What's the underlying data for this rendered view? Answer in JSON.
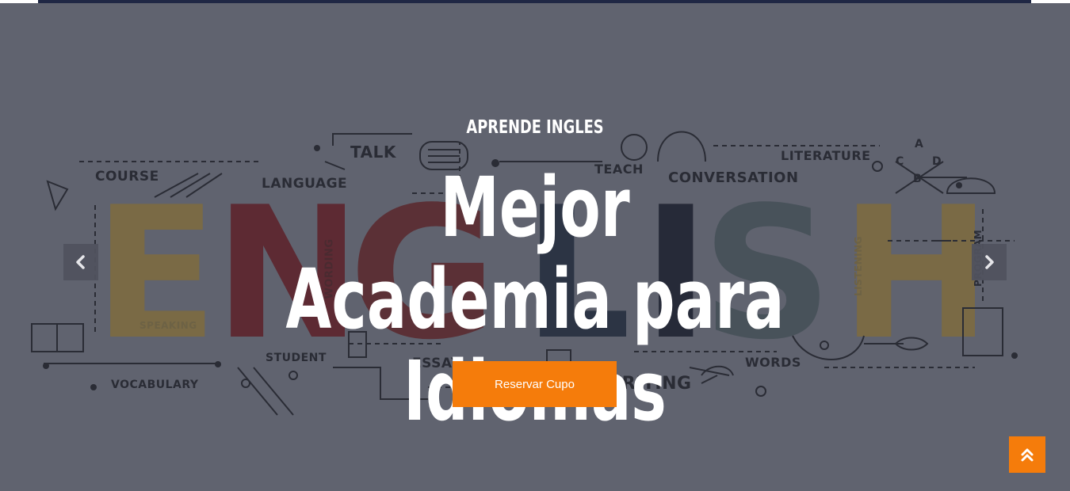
{
  "hero": {
    "subtitle": "APRENDE INGLES",
    "headline_line1": "Mejor Academia para",
    "headline_line2": "Idiomas",
    "cta_label": "Reservar Cupo",
    "background_word": "ENGLISH",
    "background_labels": [
      "COURSE",
      "LANGUAGE",
      "TALK",
      "TEACH",
      "CONVERSATION",
      "LITERATURE",
      "VOCABULARY",
      "STUDENT",
      "ESSAY",
      "WRITING",
      "WORDS",
      "SPEAKING",
      "WORDING",
      "LISTENING",
      "PROGRAM",
      "A",
      "B",
      "C",
      "D"
    ]
  },
  "controls": {
    "prev_icon": "chevron-left-icon",
    "next_icon": "chevron-right-icon",
    "scroll_top_icon": "double-chevron-up-icon"
  },
  "colors": {
    "overlay": "#60636f",
    "accent": "#f57c0b",
    "topbar": "#1f2744",
    "letter_yellow": "#7a6a45",
    "letter_red": "#5d2a33",
    "letter_navy": "#2a2f3e",
    "letter_slate": "#48525a"
  }
}
